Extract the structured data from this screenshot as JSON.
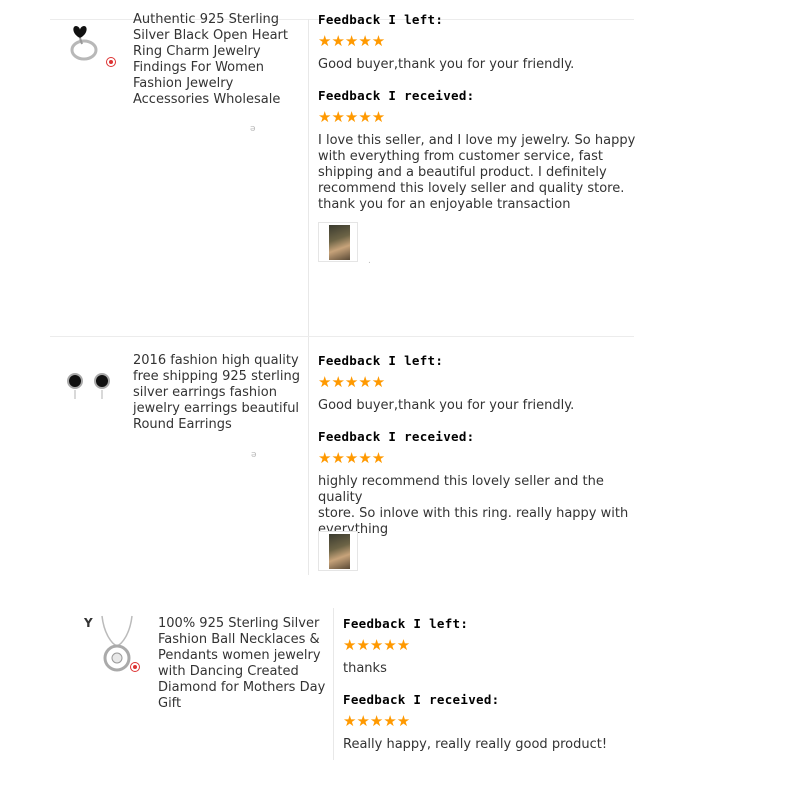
{
  "items": [
    {
      "title_lines": [
        "Authentic 925 Sterling",
        "Silver Black Open Heart",
        "Ring Charm Jewelry",
        "Findings For Women",
        "Fashion Jewelry",
        "Accessories Wholesale"
      ],
      "feedback_left_label": "Feedback I left:",
      "feedback_left_stars": "★★★★★",
      "feedback_left_text": "Good buyer,thank you for your friendly.",
      "feedback_received_label": "Feedback I received:",
      "feedback_received_stars": "★★★★★",
      "feedback_received_lines": [
        "I love this seller, and I love my jewelry. So happy",
        "with everything from customer service, fast",
        "shipping and a beautiful product. I definitely",
        "recommend this lovely seller and quality store.",
        "thank you for an enjoyable transaction"
      ],
      "rating": 5
    },
    {
      "title_lines": [
        "2016 fashion high quality",
        "free shipping 925 sterling",
        "silver earrings fashion",
        "jewelry earrings beautiful",
        "Round Earrings"
      ],
      "feedback_left_label": "Feedback I left:",
      "feedback_left_stars": "★★★★★",
      "feedback_left_text": "Good buyer,thank you for your friendly.",
      "feedback_received_label": "Feedback I received:",
      "feedback_received_stars": "★★★★★",
      "feedback_received_lines": [
        "highly recommend this lovely seller and the quality",
        "store. So inlove with this ring. really happy with",
        "everything"
      ],
      "rating": 5
    },
    {
      "title_lines": [
        "100% 925 Sterling Silver",
        "Fashion Ball Necklaces &",
        "Pendants women jewelry",
        "with Dancing Created",
        "Diamond for Mothers Day",
        "Gift"
      ],
      "feedback_left_label": "Feedback I left:",
      "feedback_left_stars": "★★★★★",
      "feedback_left_text": "thanks",
      "feedback_received_label": "Feedback I received:",
      "feedback_received_stars": "★★★★★",
      "feedback_received_lines": [
        "Really happy, really really good product!"
      ],
      "rating": 5
    }
  ],
  "colors": {
    "star": "#ff9900",
    "divider": "#ececec",
    "text": "#333333"
  }
}
